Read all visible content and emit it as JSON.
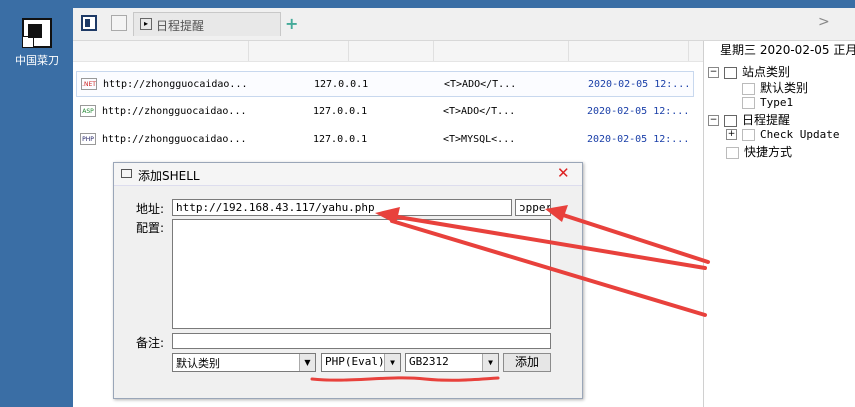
{
  "desktop": {
    "icon_label": "中国菜刀",
    "icon": "app-shortcut-icon"
  },
  "tabs": [
    {
      "label": "日程提醒",
      "icon": "calendar-icon"
    }
  ],
  "tabbar": {
    "add_icon": "+",
    "next_icon": ">"
  },
  "list": {
    "rows": [
      {
        "badge": ".NET",
        "url": "http://zhongguocaidao...",
        "ip": "127.0.0.1",
        "config": "<T>ADO</T...",
        "time": "2020-02-05 12:..."
      },
      {
        "badge": "ASP",
        "url": "http://zhongguocaidao...",
        "ip": "127.0.0.1",
        "config": "<T>ADO</T...",
        "time": "2020-02-05 12:..."
      },
      {
        "badge": "PHP",
        "url": "http://zhongguocaidao...",
        "ip": "127.0.0.1",
        "config": "<T>MYSQL<...",
        "time": "2020-02-05 12:..."
      }
    ]
  },
  "sidebar": {
    "date": "星期三 2020-02-05 正月",
    "tree": [
      {
        "label": "站点类别",
        "toggle": "−"
      },
      {
        "label": "默认类别"
      },
      {
        "label": "Type1"
      },
      {
        "label": "日程提醒",
        "toggle": "−"
      },
      {
        "label": "Check Update",
        "toggle": "+"
      },
      {
        "label": "快捷方式"
      }
    ]
  },
  "dialog": {
    "title": "添加SHELL",
    "close": "✕",
    "address_label": "地址:",
    "address_value": "http://192.168.43.117/yahu.php",
    "password_value": "ɔpper",
    "config_label": "配置:",
    "config_value": "",
    "note_label": "备注:",
    "note_value": "",
    "category_select": "默认类别",
    "script_select": "PHP(Eval)",
    "encoding_select": "GB2312",
    "dropdown_arrow": "▼",
    "add_button": "添加"
  },
  "annotations": {
    "arrow_color": "#e8413c",
    "underline_color": "#e8413c"
  }
}
